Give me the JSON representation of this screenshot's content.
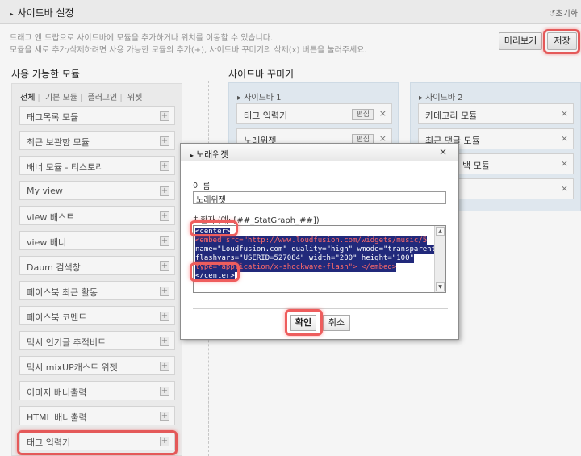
{
  "header": {
    "title": "사이드바 설정",
    "reset": "초기화"
  },
  "help": {
    "line1": "드래그 앤 드랍으로 사이드바에 모듈을 추가하거나 위치를 이동할 수 있습니다.",
    "line2": "모듈을 새로 추가/삭제하려면 사용 가능한 모듈의 추가(+), 사이드바 꾸미기의 삭제(x) 버튼을 눌러주세요."
  },
  "toolbar": {
    "preview_label": "미리보기",
    "save_label": "저장"
  },
  "available": {
    "title": "사용 가능한 모듈",
    "filters": [
      "전체",
      "기본 모듈",
      "플러그인",
      "위젯"
    ],
    "modules": [
      "태그목록 모듈",
      "최근 보관함 모듈",
      "배너 모듈 - 티스토리",
      "My view",
      "view 배스트",
      "view 배너",
      "Daum 검색창",
      "페이스북 최근 활동",
      "페이스북 코멘트",
      "믹시 인기글 추적비트",
      "믹시 mixUP캐스트 위젯",
      "이미지 배너출력",
      "HTML 배너출력",
      "태그 입력기"
    ]
  },
  "decorate": {
    "title": "사이드바 꾸미기",
    "sidebar1": {
      "title": "사이드바 1",
      "items": [
        "태그 입력기",
        "노래위젯"
      ],
      "edit_label": "편집"
    },
    "sidebar2": {
      "title": "사이드바 2",
      "items": [
        "카테고리 모듈",
        "최근 댓글 모듈",
        "백 모듈"
      ]
    }
  },
  "dialog": {
    "title": "노래위젯",
    "name_label": "이 름",
    "name_value": "노래위젯",
    "replace_label": "치환자 (예: [##_StatGraph_##])",
    "code_lines": [
      "<center>",
      "<embed src=\"http://www.loudfusion.com/widgets/music/5",
      "name=\"Loudfusion.com\" quality=\"high\" wmode=\"transparent\"",
      "flashvars=\"USERID=527084\" width=\"200\" height=\"100\"",
      "type=\"application/x-shockwave-flash\"> </embed>",
      "</center>"
    ],
    "confirm_label": "확인",
    "cancel_label": "취소"
  },
  "colors": {
    "highlight": "#ee5d5d",
    "selection": "#21297b",
    "sidebar_bg": "#e9f1f8"
  }
}
